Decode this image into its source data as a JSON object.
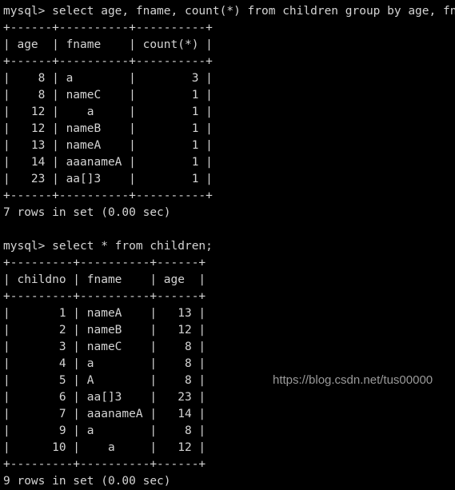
{
  "terminal": {
    "background_color": "#000000",
    "text_color": "#d4d4d4",
    "lines": [
      "mysql> select age, fname, count(*) from children group by age, fname;",
      "+------+----------+----------+",
      "| age  | fname    | count(*) |",
      "+------+----------+----------+",
      "|    8 | a        |        3 |",
      "|    8 | nameC    |        1 |",
      "|   12 |    a     |        1 |",
      "|   12 | nameB    |        1 |",
      "|   13 | nameA    |        1 |",
      "|   14 | aaanameA |        1 |",
      "|   23 | aa[]3    |        1 |",
      "+------+----------+----------+",
      "7 rows in set (0.00 sec)",
      "",
      "mysql> select * from children;",
      "+---------+----------+------+",
      "| childno | fname    | age  |",
      "+---------+----------+------+",
      "|       1 | nameA    |   13 |",
      "|       2 | nameB    |   12 |",
      "|       3 | nameC    |    8 |",
      "|       4 | a        |    8 |",
      "|       5 | A        |    8 |",
      "|       6 | aa[]3    |   23 |",
      "|       7 | aaanameA |   14 |",
      "|       9 | a        |    8 |",
      "|      10 |    a     |   12 |",
      "+---------+----------+------+",
      "9 rows in set (0.00 sec)"
    ],
    "queries": [
      {
        "prompt": "mysql>",
        "sql": "select age, fname, count(*) from children group by age, fname;",
        "columns": [
          "age",
          "fname",
          "count(*)"
        ],
        "rows": [
          [
            "8",
            "a",
            "3"
          ],
          [
            "8",
            "nameC",
            "1"
          ],
          [
            "12",
            "   a",
            "1"
          ],
          [
            "12",
            "nameB",
            "1"
          ],
          [
            "13",
            "nameA",
            "1"
          ],
          [
            "14",
            "aaanameA",
            "1"
          ],
          [
            "23",
            "aa[]3",
            "1"
          ]
        ],
        "status": "7 rows in set (0.00 sec)"
      },
      {
        "prompt": "mysql>",
        "sql": "select * from children;",
        "columns": [
          "childno",
          "fname",
          "age"
        ],
        "rows": [
          [
            "1",
            "nameA",
            "13"
          ],
          [
            "2",
            "nameB",
            "12"
          ],
          [
            "3",
            "nameC",
            "8"
          ],
          [
            "4",
            "a",
            "8"
          ],
          [
            "5",
            "A",
            "8"
          ],
          [
            "6",
            "aa[]3",
            "23"
          ],
          [
            "7",
            "aaanameA",
            "14"
          ],
          [
            "9",
            "a",
            "8"
          ],
          [
            "10",
            "   a",
            "12"
          ]
        ],
        "status": "9 rows in set (0.00 sec)"
      }
    ]
  },
  "watermark": {
    "text": "https://blog.csdn.net/tus00000",
    "color": "#9a9a9a"
  }
}
